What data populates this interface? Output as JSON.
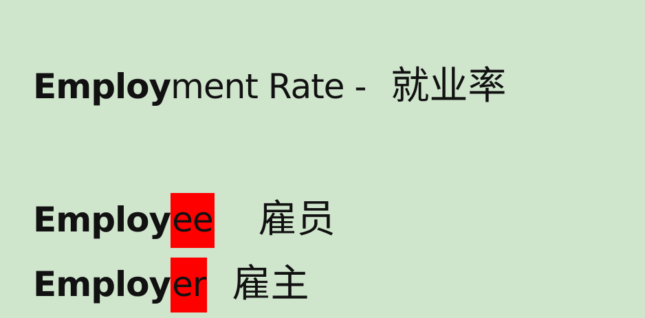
{
  "line1": {
    "bold": "Employ",
    "regular": "ment Rate -",
    "chinese": "就业率"
  },
  "line2": {
    "bold": "Employ",
    "highlight": "ee",
    "chinese": "雇员"
  },
  "line3": {
    "bold": "Employ",
    "highlight": "er",
    "chinese": "雇主"
  },
  "colors": {
    "background": "#cfe5cc",
    "highlight": "#ff0000",
    "text": "#111111"
  }
}
